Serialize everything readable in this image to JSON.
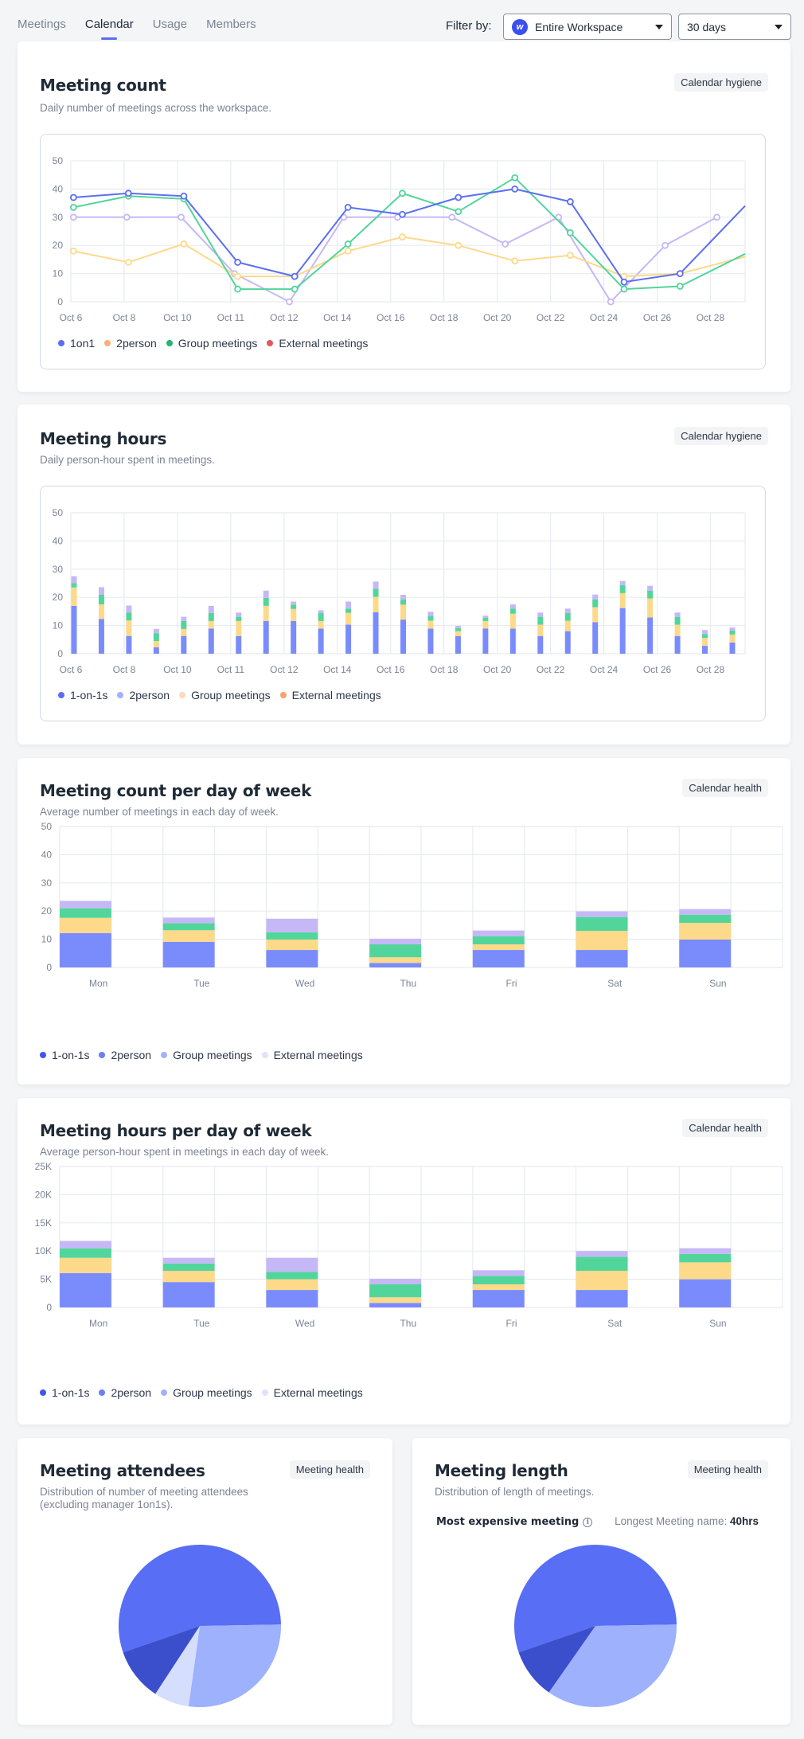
{
  "nav": {
    "tabs": [
      {
        "label": "Meetings",
        "active": false
      },
      {
        "label": "Calendar",
        "active": true
      },
      {
        "label": "Usage",
        "active": false
      },
      {
        "label": "Members",
        "active": false
      }
    ],
    "filter_label": "Filter by:",
    "workspace_select": {
      "badge": "w",
      "value": "Entire Workspace"
    },
    "range_select": {
      "value": "30 days"
    }
  },
  "colors": {
    "accent": "#5b6cf0",
    "blue": "#5a6ef5",
    "yellow": "#fdd98a",
    "green": "#52d59b",
    "lavender": "#c6b8f7",
    "bar_blue": "#7a8cfc"
  },
  "cards": {
    "meeting_count": {
      "title": "Meeting count",
      "subtitle": "Daily number of meetings across the workspace.",
      "badge": "Calendar hygiene"
    },
    "meeting_hours": {
      "title": "Meeting hours",
      "subtitle": "Daily person-hour spent in meetings.",
      "badge": "Calendar hygiene"
    },
    "count_dow": {
      "title": "Meeting count per day of week",
      "subtitle": "Average number of meetings in each day of week.",
      "badge": "Calendar health"
    },
    "hours_dow": {
      "title": "Meeting hours per day of week",
      "subtitle": "Average person-hour spent in meetings in each day of week.",
      "badge": "Calendar health"
    },
    "attendees": {
      "title": "Meeting attendees",
      "subtitle_line1": "Distribution of number of meeting attendees",
      "subtitle_line2": "(excluding manager 1on1s).",
      "badge": "Meeting health"
    },
    "length": {
      "title": "Meeting length",
      "subtitle": "Distribution of length of meetings.",
      "badge": "Meeting health",
      "expensive_label": "Most expensive meeting",
      "longest_label": "Longest Meeting name:",
      "longest_value": "40hrs"
    }
  },
  "chart_data": [
    {
      "id": "meeting_count",
      "type": "line",
      "title": "Meeting count",
      "x_tick_labels": [
        "Oct 6",
        "Oct 8",
        "Oct 10",
        "Oct 11",
        "Oct 12",
        "Oct 14",
        "Oct 16",
        "Oct 18",
        "Oct 20",
        "Oct 22",
        "Oct 24",
        "Oct 26",
        "Oct 28"
      ],
      "ylim": [
        0,
        50
      ],
      "y_ticks": [
        0,
        10,
        20,
        30,
        40,
        50
      ],
      "grid": true,
      "legend": [
        {
          "name": "1on1",
          "color": "#5a6ef5"
        },
        {
          "name": "2person",
          "color": "#fbb07a"
        },
        {
          "name": "Group meetings",
          "color": "#22b573"
        },
        {
          "name": "External meetings",
          "color": "#e05a5a"
        }
      ],
      "series": [
        {
          "name": "1on1",
          "color": "#5a6ef5",
          "x": [
            0.05,
            1.08,
            2.12,
            3.13,
            4.2,
            5.2,
            6.22,
            7.27,
            8.33,
            9.37,
            10.38,
            11.43
          ],
          "values": [
            37,
            38.5,
            37.5,
            14,
            9,
            33.5,
            31,
            37,
            40,
            35.5,
            7,
            10
          ]
        },
        {
          "name": "2person",
          "color": "#fdd98a",
          "x": [
            0.05,
            1.08,
            2.12,
            3.13,
            4.2,
            5.2,
            6.22,
            7.27,
            8.33,
            9.37,
            10.38,
            11.43
          ],
          "values": [
            18,
            14,
            20.5,
            9,
            9,
            18,
            23,
            20,
            14.5,
            16.5,
            9,
            10
          ]
        },
        {
          "name": "Group meetings",
          "color": "#52d59b",
          "x": [
            0.05,
            1.08,
            2.12,
            3.13,
            4.2,
            5.2,
            6.22,
            7.27,
            8.33,
            9.37,
            10.38,
            11.43
          ],
          "values": [
            33.5,
            37.5,
            36.5,
            4.5,
            4.5,
            20.5,
            38.5,
            32,
            44,
            24.5,
            4.5,
            5.5
          ]
        },
        {
          "name": "lavender",
          "color": "#c6b8f7",
          "x": [
            0.05,
            1.05,
            2.07,
            3.07,
            4.1,
            5.12,
            6.13,
            7.15,
            8.15,
            9.15,
            10.13,
            11.15,
            12.12
          ],
          "values": [
            30,
            30,
            30,
            10,
            0,
            30,
            30,
            30,
            20.5,
            30,
            0,
            20,
            30
          ]
        }
      ],
      "tail_segments": [
        {
          "series": "1on1",
          "to_value": 34
        },
        {
          "series": "2person",
          "to_value": 16
        },
        {
          "series": "Group meetings",
          "to_value": 17
        }
      ]
    },
    {
      "id": "meeting_hours",
      "type": "bar",
      "stacked": true,
      "title": "Meeting hours",
      "x_tick_labels": [
        "Oct 6",
        "Oct 8",
        "Oct 10",
        "Oct 11",
        "Oct 12",
        "Oct 14",
        "Oct 16",
        "Oct 18",
        "Oct 20",
        "Oct 22",
        "Oct 24",
        "Oct 26",
        "Oct 28"
      ],
      "ylim": [
        0,
        50
      ],
      "y_ticks": [
        0,
        10,
        20,
        30,
        40,
        50
      ],
      "grid": true,
      "legend": [
        {
          "name": "1-on-1s",
          "color": "#5a6ef5"
        },
        {
          "name": "2person",
          "color": "#a3b1fb"
        },
        {
          "name": "Group meetings",
          "color": "#fcd9bd"
        },
        {
          "name": "External meetings",
          "color": "#f7a36f"
        }
      ],
      "stack_colors": [
        "#7a8cfc",
        "#fdd98a",
        "#52d59b",
        "#c6b8f7"
      ],
      "bars": [
        [
          17,
          6.5,
          1.5,
          2.5
        ],
        [
          12.3,
          5.2,
          3.5,
          2.6
        ],
        [
          6.3,
          5.5,
          2.8,
          2.5
        ],
        [
          2.3,
          2.2,
          2.8,
          1.5
        ],
        [
          6.3,
          2.5,
          2.8,
          1.5
        ],
        [
          8.9,
          2.7,
          2.8,
          2.6
        ],
        [
          6.3,
          5.3,
          1.5,
          1.5
        ],
        [
          11.6,
          5.4,
          2.8,
          2.6
        ],
        [
          11.6,
          4.3,
          1.5,
          1.1
        ],
        [
          8.9,
          2.7,
          2.8,
          1.0
        ],
        [
          10.3,
          4.2,
          1.5,
          2.5
        ],
        [
          14.7,
          5.5,
          2.8,
          2.6
        ],
        [
          12.1,
          5.3,
          1.8,
          1.7
        ],
        [
          8.9,
          2.8,
          1.7,
          1.5
        ],
        [
          6.3,
          1.7,
          1.1,
          0.8
        ],
        [
          8.9,
          2.7,
          1.1,
          0.8
        ],
        [
          8.9,
          5.3,
          1.8,
          1.5
        ],
        [
          6.3,
          4.0,
          2.8,
          1.5
        ],
        [
          8.0,
          3.7,
          2.8,
          1.5
        ],
        [
          11.2,
          5.3,
          2.8,
          1.7
        ],
        [
          16.2,
          5.3,
          2.8,
          1.5
        ],
        [
          12.9,
          6.7,
          2.8,
          1.7
        ],
        [
          6.3,
          4.0,
          2.8,
          1.5
        ],
        [
          2.8,
          2.8,
          1.4,
          1.4
        ],
        [
          4.0,
          2.8,
          1.4,
          1.1
        ]
      ]
    },
    {
      "id": "count_dow",
      "type": "bar",
      "stacked": true,
      "title": "Meeting count per day of week",
      "categories": [
        "Mon",
        "Tue",
        "Wed",
        "Thu",
        "Fri",
        "Sat",
        "Sun"
      ],
      "ylim": [
        0,
        50
      ],
      "y_ticks": [
        0,
        10,
        20,
        30,
        40,
        50
      ],
      "grid": true,
      "legend": [
        {
          "name": "1-on-1s",
          "color": "#3f55ee"
        },
        {
          "name": "2person",
          "color": "#6a7ef7"
        },
        {
          "name": "Group meetings",
          "color": "#a3b1fb"
        },
        {
          "name": "External meetings",
          "color": "#dde3fd"
        }
      ],
      "stack_colors": [
        "#7a8cfc",
        "#fdd98a",
        "#52d59b",
        "#c6b8f7"
      ],
      "series": [
        {
          "name": "segment1",
          "values": [
            12.2,
            9.1,
            6.2,
            1.6,
            6.2,
            6.2,
            9.9
          ]
        },
        {
          "name": "segment2",
          "values": [
            5.4,
            4.1,
            3.7,
            2.0,
            2.0,
            6.8,
            5.9
          ]
        },
        {
          "name": "segment3",
          "values": [
            3.4,
            2.5,
            2.6,
            4.6,
            2.9,
            4.9,
            2.9
          ]
        },
        {
          "name": "segment4",
          "values": [
            2.6,
            2.0,
            4.8,
            2.0,
            2.0,
            2.0,
            2.0
          ]
        }
      ]
    },
    {
      "id": "hours_dow",
      "type": "bar",
      "stacked": true,
      "title": "Meeting hours per day of week",
      "categories": [
        "Mon",
        "Tue",
        "Wed",
        "Thu",
        "Fri",
        "Sat",
        "Sun"
      ],
      "ylim": [
        0,
        25000
      ],
      "y_ticks": [
        0,
        5000,
        10000,
        15000,
        20000,
        25000
      ],
      "y_tick_labels": [
        "0",
        "5K",
        "10K",
        "15K",
        "20K",
        "25K"
      ],
      "grid": true,
      "legend": [
        {
          "name": "1-on-1s",
          "color": "#3f55ee"
        },
        {
          "name": "2person",
          "color": "#6a7ef7"
        },
        {
          "name": "Group meetings",
          "color": "#a3b1fb"
        },
        {
          "name": "External meetings",
          "color": "#dde3fd"
        }
      ],
      "stack_colors": [
        "#7a8cfc",
        "#fdd98a",
        "#52d59b",
        "#c6b8f7"
      ],
      "series": [
        {
          "name": "segment1",
          "values": [
            6100,
            4500,
            3100,
            800,
            3100,
            3100,
            5000
          ]
        },
        {
          "name": "segment2",
          "values": [
            2700,
            2000,
            1900,
            1000,
            1000,
            3400,
            3000
          ]
        },
        {
          "name": "segment3",
          "values": [
            1700,
            1300,
            1300,
            2300,
            1500,
            2500,
            1500
          ]
        },
        {
          "name": "segment4",
          "values": [
            1300,
            1000,
            2500,
            1000,
            1000,
            1000,
            1000
          ]
        }
      ]
    },
    {
      "id": "attendees",
      "type": "pie",
      "title": "Meeting attendees",
      "slices": [
        {
          "label": "slice-1",
          "value": 55.0,
          "color": "#586ef5"
        },
        {
          "label": "slice-2",
          "value": 27.5,
          "color": "#9db1fd"
        },
        {
          "label": "slice-3",
          "value": 7.0,
          "color": "#d6defd"
        },
        {
          "label": "slice-4",
          "value": 10.5,
          "color": "#3b4fcc"
        }
      ]
    },
    {
      "id": "length",
      "type": "pie",
      "title": "Meeting length",
      "slices": [
        {
          "label": "slice-1",
          "value": 55.0,
          "color": "#586ef5"
        },
        {
          "label": "slice-2",
          "value": 35.0,
          "color": "#9db1fd"
        },
        {
          "label": "slice-3",
          "value": 10.0,
          "color": "#3b4fcc"
        }
      ]
    }
  ]
}
